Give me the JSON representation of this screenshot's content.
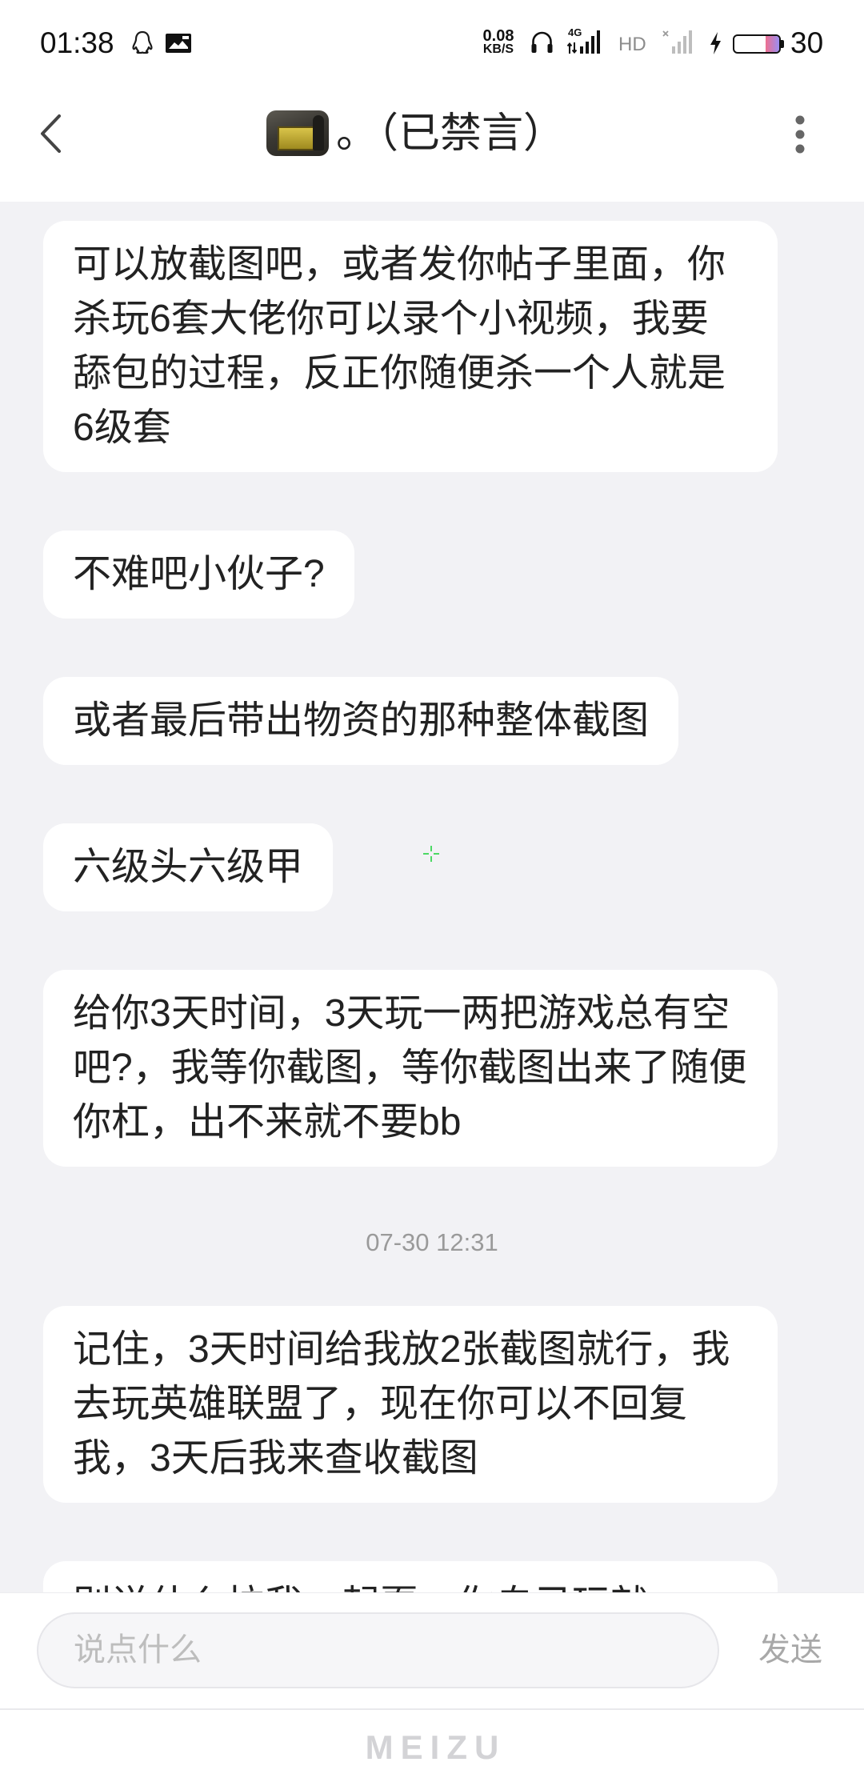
{
  "status_bar": {
    "time": "01:38",
    "net_speed": {
      "value": "0.08",
      "unit": "KB/S"
    },
    "network_type": "4G",
    "hd_label": "HD",
    "battery_percent": "30",
    "left_icons": [
      "qq-icon",
      "gallery-icon"
    ],
    "right_icons": [
      "headphones-icon",
      "signal-4g-icon",
      "signal-no-service-icon",
      "charging-icon",
      "battery-icon"
    ]
  },
  "header": {
    "back_icon": "chevron-left-icon",
    "title": "。（已禁言）",
    "more_icon": "more-vertical-icon"
  },
  "chat": {
    "items": [
      {
        "type": "message",
        "lines": [
          "可以放截图吧，或者发你帖子里面，你",
          "杀玩6套大佬你可以录个小视频，我要",
          "舔包的过程，反正你随便杀一个人就是",
          "6级套"
        ]
      },
      {
        "type": "message",
        "lines": [
          "不难吧小伙子?"
        ]
      },
      {
        "type": "message",
        "lines": [
          "或者最后带出物资的那种整体截图"
        ]
      },
      {
        "type": "message",
        "lines": [
          "六级头六级甲"
        ]
      },
      {
        "type": "message",
        "lines": [
          "给你3天时间，3天玩一两把游戏总有空",
          "吧?，我等你截图，等你截图出来了随便",
          "你杠，出不来就不要bb"
        ]
      },
      {
        "type": "timestamp",
        "text": "07-30 12:31"
      },
      {
        "type": "message",
        "lines": [
          "记住，3天时间给我放2张截图就行，我",
          "去玩英雄联盟了，现在你可以不回复",
          "我，3天后我来查收截图"
        ]
      },
      {
        "type": "message",
        "lines": [
          "别说什么拉我一起耍，你自己玩就"
        ]
      }
    ]
  },
  "composer": {
    "placeholder": "说点什么",
    "send_label": "发送"
  },
  "footer": {
    "brand_logo": "MEIZU"
  },
  "colors": {
    "chat_background": "#f2f2f5",
    "bubble_background": "#ffffff",
    "message_text": "#222222",
    "timestamp_text": "#9a9a9a",
    "placeholder_text": "#bdbdbd",
    "send_text": "#a8a8a8"
  }
}
